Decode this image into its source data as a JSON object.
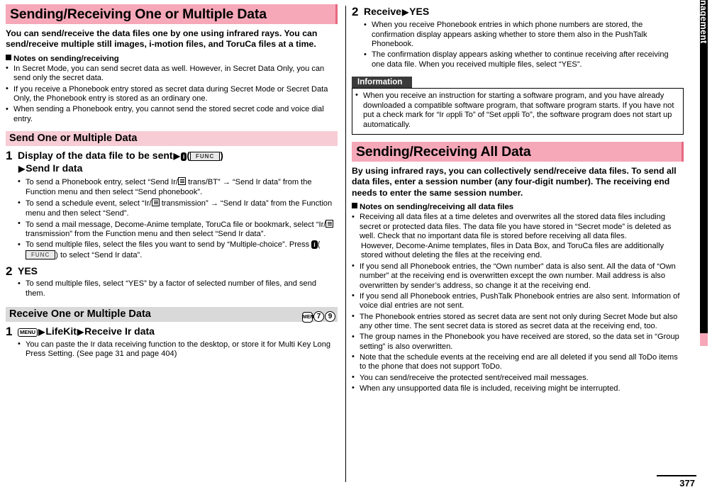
{
  "page_number": "377",
  "side_tab": "Data Management",
  "left": {
    "title": "Sending/Receiving One or Multiple Data",
    "lead": "You can send/receive the data files one by one using infrared rays. You can send/receive multiple still images, i-motion files, and ToruCa files at a time.",
    "notes_head": "Notes on sending/receiving",
    "notes": [
      "In Secret Mode, you can send secret data as well. However, in Secret Data Only, you can send only the secret data.",
      "If you receive a Phonebook entry stored as secret data during Secret Mode or Secret Data Only, the Phonebook entry is stored as an ordinary one.",
      "When sending a Phonebook entry, you cannot send the stored secret code and voice dial entry."
    ],
    "section1": {
      "heading": "Send One or Multiple Data",
      "step1": {
        "num": "1",
        "title_a": "Display of the data file to be sent",
        "func_label": "FUNC",
        "title_b": "Send Ir data",
        "bullets": [
          "To send a Phonebook entry, select “Send Ir/    trans/BT” → “Send Ir data” from the Function menu and then select “Send phonebook”.",
          "To send a schedule event, select “Ir/    transmission” → “Send Ir data” from the Function menu and then select “Send”.",
          "To send a mail message, Decome-Anime template, ToruCa file or bookmark, select “Ir/    transmission” from the Function menu and then select “Send Ir data”.",
          "To send multiple files, select the files you want to send by “Multiple-choice”. Press        (            ) to select “Send Ir data”."
        ]
      },
      "step2": {
        "num": "2",
        "title": "YES",
        "bullets": [
          "To send multiple files, select “YES” by a factor of selected number of files, and send them."
        ]
      }
    },
    "section2": {
      "heading": "Receive One or Multiple Data",
      "keys": [
        "MENU",
        "7",
        "9"
      ],
      "step1": {
        "num": "1",
        "menu_key": "MENU",
        "title_a": "LifeKit",
        "title_b": "Receive Ir data",
        "bullets": [
          "You can paste the Ir data receiving function to the desktop, or store it for Multi Key Long Press Setting. (See page 31 and page 404)"
        ]
      }
    }
  },
  "right": {
    "step2": {
      "num": "2",
      "title_a": "Receive",
      "title_b": "YES",
      "bullets": [
        "When you receive Phonebook entries in which phone numbers are stored, the confirmation display appears asking whether to store them also in the PushTalk Phonebook.",
        "The confirmation display appears asking whether to continue receiving after receiving one data file. When you received multiple files, select “YES”."
      ]
    },
    "information": {
      "head": "Information",
      "items": [
        "When you receive an instruction for starting a software program, and you have already downloaded a compatible software program, that software program starts. If you have not put a check mark for “Ir     αppli To” of “Set     αppli To”, the software program does not start up automatically."
      ]
    },
    "title2": "Sending/Receiving All Data",
    "lead2": "By using infrared rays, you can collectively send/receive data files. To send all data files, enter a session number (any four-digit number). The receiving end needs to enter the same session number.",
    "notes_head2": "Notes on sending/receiving all data files",
    "notes2": [
      "Receiving all data files at a time deletes and overwrites all the stored data files including secret or protected data files. The data file you have stored in “Secret mode” is deleted as well. Check that no important data file is stored before receiving all data files.",
      "If you send all Phonebook entries, the “Own number” data is also sent. All the data of “Own number” at the receiving end is overwritten except the own number. Mail address is also overwritten by sender’s address, so change it at the receiving end.",
      "If you send all Phonebook entries, PushTalk Phonebook entries are also sent. Information of voice dial entries are not sent.",
      "The Phonebook entries stored as secret data are sent not only during Secret Mode but also any other time. The sent secret data is stored as secret data at the receiving end, too.",
      "The group names in the Phonebook you have received are stored, so the data set in “Group setting” is also overwritten.",
      "Note that the schedule events at the receiving end are all deleted if you send all ToDo items to the phone that does not support ToDo.",
      "You can send/receive the protected sent/received mail messages.",
      "When any unsupported data file is included, receiving might be interrupted."
    ],
    "notes2_sub": "However, Decome-Anime templates, files in Data Box, and ToruCa files are additionally stored without deleting the files at the receiving end."
  }
}
